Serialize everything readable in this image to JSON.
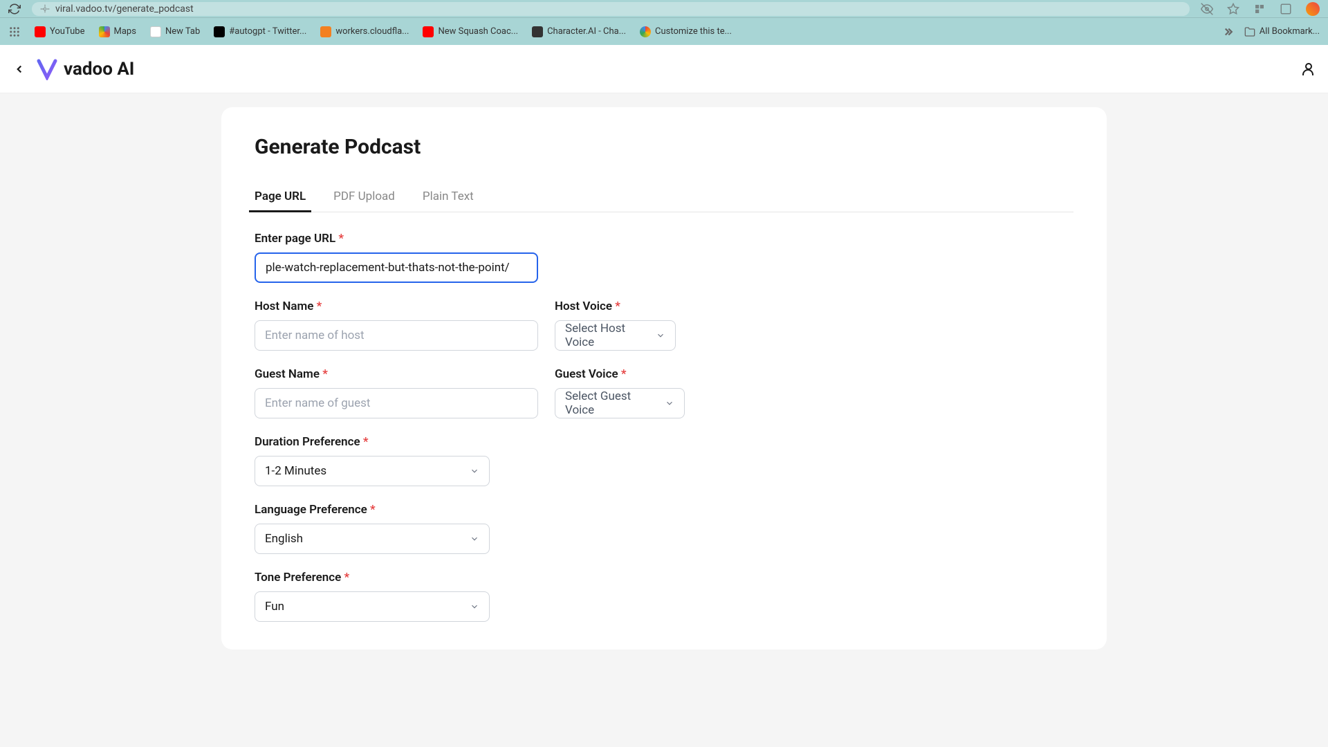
{
  "browser": {
    "url": "viral.vadoo.tv/generate_podcast"
  },
  "bookmarks": {
    "items": [
      {
        "label": "YouTube",
        "icon": "youtube"
      },
      {
        "label": "Maps",
        "icon": "maps"
      },
      {
        "label": "New Tab",
        "icon": "tab"
      },
      {
        "label": "#autogpt - Twitter...",
        "icon": "x"
      },
      {
        "label": "workers.cloudfla...",
        "icon": "cf"
      },
      {
        "label": "New Squash Coac...",
        "icon": "youtube"
      },
      {
        "label": "Character.AI - Cha...",
        "icon": "cai"
      },
      {
        "label": "Customize this te...",
        "icon": "chrome"
      }
    ],
    "all_bookmarks_label": "All Bookmark..."
  },
  "app": {
    "logo_text": "vadoo AI"
  },
  "page": {
    "title": "Generate Podcast",
    "tabs": [
      {
        "label": "Page URL",
        "active": true
      },
      {
        "label": "PDF Upload",
        "active": false
      },
      {
        "label": "Plain Text",
        "active": false
      }
    ]
  },
  "form": {
    "page_url": {
      "label": "Enter page URL",
      "value": "ple-watch-replacement-but-thats-not-the-point/"
    },
    "host_name": {
      "label": "Host Name",
      "placeholder": "Enter name of host",
      "value": ""
    },
    "host_voice": {
      "label": "Host Voice",
      "selected": "Select Host Voice"
    },
    "guest_name": {
      "label": "Guest Name",
      "placeholder": "Enter name of guest",
      "value": ""
    },
    "guest_voice": {
      "label": "Guest Voice",
      "selected": "Select Guest Voice"
    },
    "duration": {
      "label": "Duration Preference",
      "selected": "1-2 Minutes"
    },
    "language": {
      "label": "Language Preference",
      "selected": "English"
    },
    "tone": {
      "label": "Tone Preference",
      "selected": "Fun"
    }
  }
}
